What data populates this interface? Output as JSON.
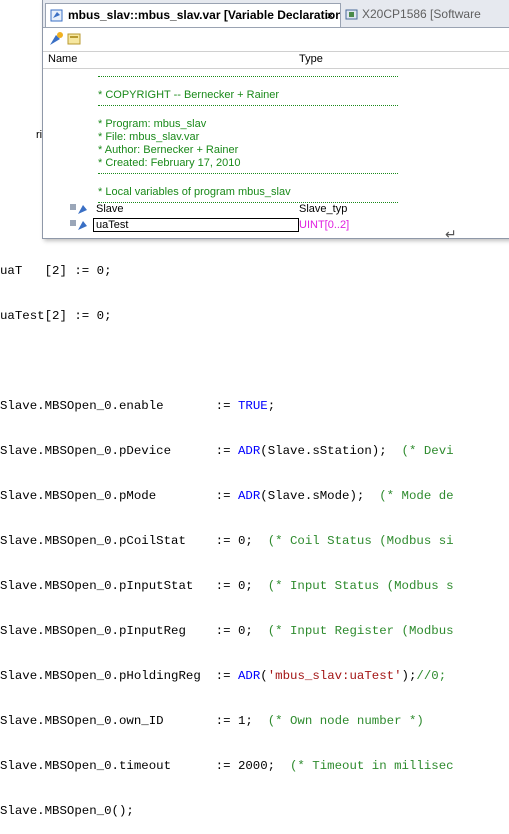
{
  "tabs": {
    "active": "mbus_slav::mbus_slav.var [Variable Declaration]",
    "close": "×",
    "inactive": "X20CP1586 [Software"
  },
  "columns": {
    "name": "Name",
    "type": "Type"
  },
  "comment_block": {
    "copyright": "* COPYRIGHT -- Bernecker + Rainer",
    "program": "* Program: mbus_slav",
    "file": "* File: mbus_slav.var",
    "author": "* Author: Bernecker + Rainer",
    "created": "* Created: February 17, 2010",
    "locals": "* Local variables of program mbus_slav"
  },
  "variables": [
    {
      "name": "Slave",
      "type": "Slave_typ"
    },
    {
      "name": "uaTest",
      "type": "UINT[0..2]"
    }
  ],
  "left_fragment": "ri",
  "return_arrow": "↵",
  "code": {
    "line0_a": "uaT",
    "line0_b": "[2] := 0;",
    "line1": "uaTest[2] := 0;",
    "l3_lhs": "Slave.MBSOpen_0.enable       := ",
    "l3_kw": "TRUE",
    "l3_end": ";",
    "l4_lhs": "Slave.MBSOpen_0.pDevice      := ",
    "l4_kw": "ADR",
    "l4_mid": "(Slave.sStation);  ",
    "l4_cm": "(* Devi",
    "l5_lhs": "Slave.MBSOpen_0.pMode        := ",
    "l5_kw": "ADR",
    "l5_mid": "(Slave.sMode);  ",
    "l5_cm": "(* Mode de",
    "l6_lhs": "Slave.MBSOpen_0.pCoilStat    := 0;  ",
    "l6_cm": "(* Coil Status (Modbus si",
    "l7_lhs": "Slave.MBSOpen_0.pInputStat   := 0;  ",
    "l7_cm": "(* Input Status (Modbus s",
    "l8_lhs": "Slave.MBSOpen_0.pInputReg    := 0;  ",
    "l8_cm": "(* Input Register (Modbus",
    "l9_lhs": "Slave.MBSOpen_0.pHoldingReg  := ",
    "l9_kw": "ADR",
    "l9_p1": "(",
    "l9_str": "'mbus_slav:uaTest'",
    "l9_p2": ");",
    "l9_cm": "//0;",
    "l10_lhs": "Slave.MBSOpen_0.own_ID       := 1;  ",
    "l10_cm": "(* Own node number *)",
    "l11_lhs": "Slave.MBSOpen_0.timeout      := 2000;  ",
    "l11_cm": "(* Timeout in millisec",
    "l12": "Slave.MBSOpen_0();"
  }
}
